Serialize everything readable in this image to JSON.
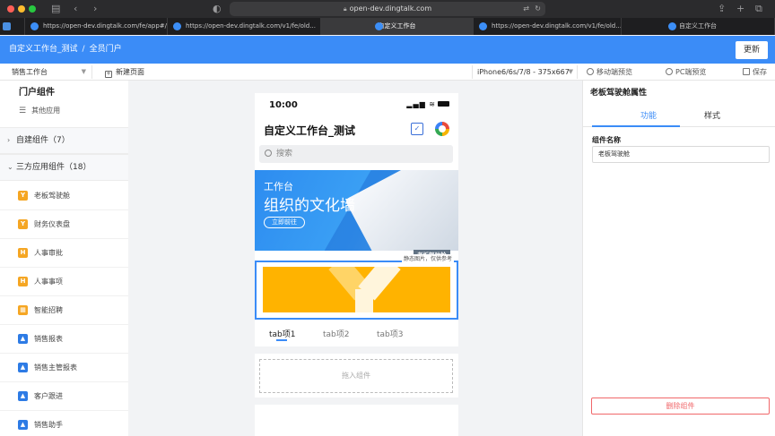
{
  "browser": {
    "address": "open-dev.dingtalk.com",
    "tabs": [
      {
        "label": ""
      },
      {
        "label": "https://open-dev.dingtalk.com/fe/app#/..."
      },
      {
        "label": "https://open-dev.dingtalk.com/v1/fe/old..."
      },
      {
        "label": "自定义工作台"
      },
      {
        "label": "https://open-dev.dingtalk.com/v1/fe/old..."
      },
      {
        "label": "自定义工作台"
      }
    ]
  },
  "header": {
    "breadcrumb_app": "自定义工作台_测试",
    "breadcrumb_sep": "/",
    "breadcrumb_page": "全员门户",
    "update_label": "更新"
  },
  "toolbar": {
    "page_select": "销售工作台",
    "new_page": "新建页面",
    "device": "iPhone6/6s/7/8 - 375x667",
    "mobile_preview": "移动端预览",
    "pc_preview": "PC端预览",
    "save": "保存"
  },
  "left": {
    "title": "门户组件",
    "other_apps": "其他应用",
    "section_custom": "自建组件（7）",
    "section_third": "三方应用组件（18）",
    "components": [
      {
        "icon": "Y",
        "label": "老板驾驶舱",
        "color": "#f5a623"
      },
      {
        "icon": "Y",
        "label": "财务仪表盘",
        "color": "#f5a623"
      },
      {
        "icon": "H",
        "label": "人事审批",
        "color": "#f5a623"
      },
      {
        "icon": "H",
        "label": "人事事项",
        "color": "#f5a623"
      },
      {
        "icon": "▦",
        "label": "智能招聘",
        "color": "#f5a623"
      },
      {
        "icon": "▲",
        "label": "销售报表",
        "color": "#2d7be5"
      },
      {
        "icon": "▲",
        "label": "销售主管报表",
        "color": "#2d7be5"
      },
      {
        "icon": "▲",
        "label": "客户跟进",
        "color": "#2d7be5"
      },
      {
        "icon": "▲",
        "label": "销售助手",
        "color": "#2d7be5"
      }
    ]
  },
  "phone": {
    "time": "10:00",
    "title": "自定义工作台_测试",
    "search": "搜索",
    "banner_line1": "工作台",
    "banner_line2": "组织的文化墙",
    "banner_btn": "立即前往",
    "banner_label": "老板驾驶舱",
    "static_note": "静态图片，仅供参考",
    "tabs": [
      "tab项1",
      "tab项2",
      "tab项3"
    ],
    "drop_hint": "拖入组件"
  },
  "right": {
    "title": "老板驾驶舱属性",
    "tab_function": "功能",
    "tab_style": "样式",
    "name_label": "组件名称",
    "name_value": "老板驾驶舱",
    "delete": "删除组件"
  },
  "colors": {
    "header_blue": "#3b8cf7",
    "delete_red": "#f0676a"
  }
}
